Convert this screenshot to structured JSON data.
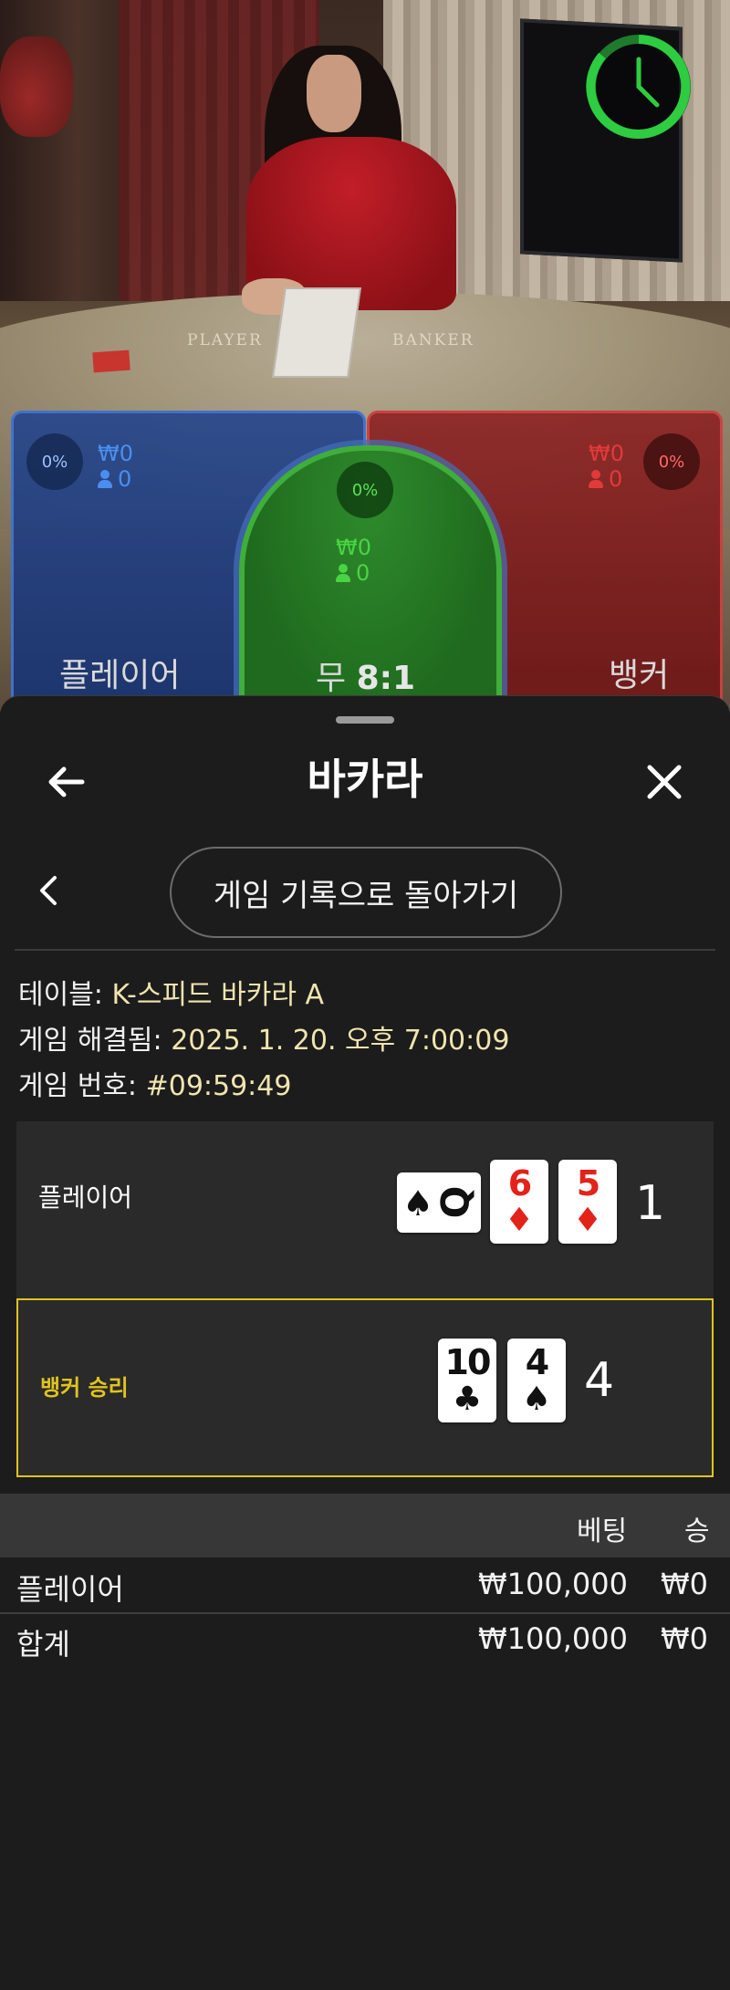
{
  "video": {
    "felt_player_label": "PLAYER",
    "felt_banker_label": "BANKER"
  },
  "bet_spots": {
    "player": {
      "percent": "0%",
      "amount": "₩0",
      "count": "0",
      "name": "플레이어"
    },
    "tie": {
      "percent": "0%",
      "amount": "₩0",
      "count": "0",
      "name": "무",
      "payout": "8:1"
    },
    "banker": {
      "percent": "0%",
      "amount": "₩0",
      "count": "0",
      "name": "뱅커"
    }
  },
  "colors": {
    "player": "#4a8ef0",
    "banker": "#e23a3a",
    "tie": "#3fbf3a",
    "highlight": "#e0c41e"
  },
  "sheet": {
    "title": "바카라",
    "back_icon": "arrow-left-icon",
    "close_icon": "close-icon",
    "prev_icon": "chevron-left-icon",
    "back_to_history": "게임 기록으로 돌아가기",
    "info": {
      "table_label": "테이블:",
      "table_value": "K-스피드 바카라 A",
      "resolved_label": "게임 해결됨:",
      "resolved_value": "2025. 1. 20. 오후 7:00:09",
      "game_no_label": "게임 번호:",
      "game_no_value": "#09:59:49"
    },
    "hands": {
      "player": {
        "label": "플레이어",
        "score": "1",
        "cards": [
          {
            "rank": "Q",
            "suit": "♠",
            "color": "black",
            "sideways": true
          },
          {
            "rank": "6",
            "suit": "♦",
            "color": "red"
          },
          {
            "rank": "5",
            "suit": "♦",
            "color": "red"
          }
        ]
      },
      "banker": {
        "label": "뱅커 승리",
        "score": "4",
        "cards": [
          {
            "rank": "10",
            "suit": "♣",
            "color": "black"
          },
          {
            "rank": "4",
            "suit": "♠",
            "color": "black"
          }
        ]
      }
    },
    "table": {
      "headers": {
        "bet": "베팅",
        "win": "승"
      },
      "rows": [
        {
          "name": "플레이어",
          "bet": "₩100,000",
          "win": "₩0"
        }
      ],
      "total": {
        "name": "합계",
        "bet": "₩100,000",
        "win": "₩0"
      }
    }
  }
}
